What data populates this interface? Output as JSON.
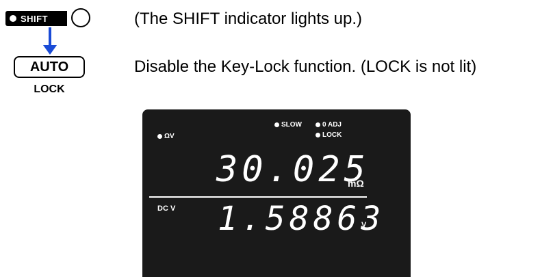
{
  "keys": {
    "shift_label": "SHIFT",
    "auto_label": "AUTO",
    "lock_label": "LOCK"
  },
  "instructions": {
    "step1": "(The SHIFT indicator lights up.)",
    "step2": "Disable the Key-Lock function. (LOCK is not lit)"
  },
  "display": {
    "indicator_ohm_v": "ΩV",
    "indicator_slow": "SLOW",
    "indicator_0adj": "0 ADJ",
    "indicator_lock": "LOCK",
    "primary_value": "30.025",
    "primary_unit": "mΩ",
    "secondary_label": "DC V",
    "secondary_value": "1.58863",
    "secondary_unit": "V"
  },
  "colors": {
    "arrow": "#1a4bd6",
    "display_bg": "#1a1a1a",
    "display_fg": "#ffffff"
  }
}
